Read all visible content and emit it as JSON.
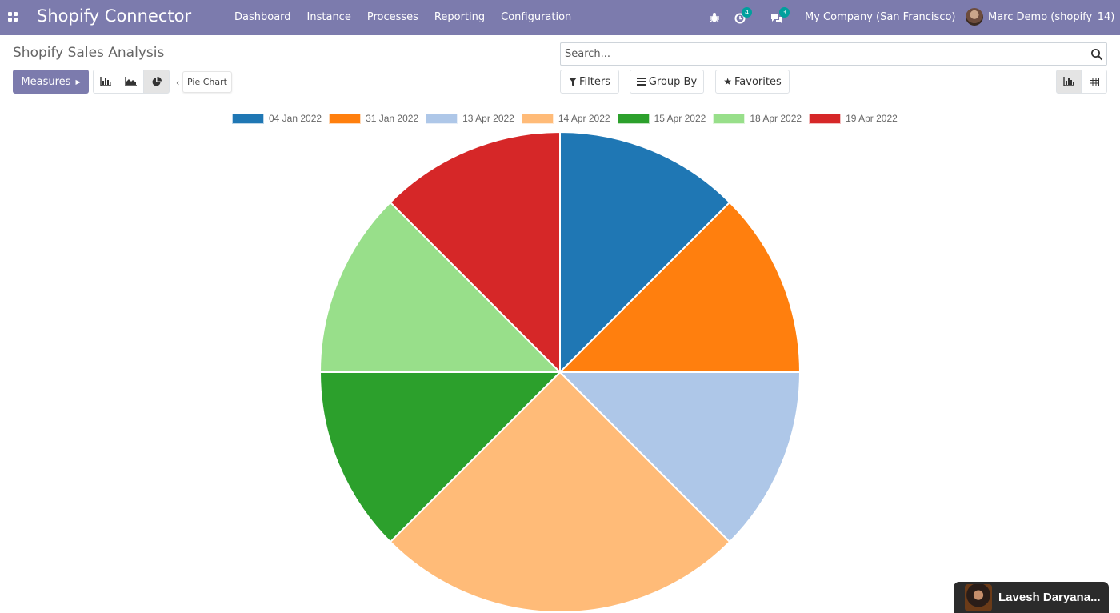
{
  "app": {
    "brand": "Shopify Connector",
    "menu": [
      "Dashboard",
      "Instance",
      "Processes",
      "Reporting",
      "Configuration"
    ],
    "activity_count": "4",
    "messages_count": "3",
    "company": "My Company (San Francisco)",
    "user": "Marc Demo (shopify_14)",
    "accent_color": "#7c7bad",
    "badge_color": "#00a09d"
  },
  "control": {
    "title": "Shopify Sales Analysis",
    "measures_label": "Measures",
    "search_placeholder": "Search...",
    "filters_label": "Filters",
    "groupby_label": "Group By",
    "favorites_label": "Favorites",
    "tooltip": "Pie Chart",
    "active_chart_mode": "pie",
    "active_view": "graph"
  },
  "chart_data": {
    "type": "pie",
    "categories": [
      "04 Jan 2022",
      "31 Jan 2022",
      "13 Apr 2022",
      "14 Apr 2022",
      "15 Apr 2022",
      "18 Apr 2022",
      "19 Apr 2022"
    ],
    "values": [
      1,
      1,
      1,
      2,
      1,
      1,
      1
    ],
    "colors": [
      "#1f77b4",
      "#ff7f0e",
      "#aec7e8",
      "#ffbb78",
      "#2ca02c",
      "#98df8a",
      "#d62728"
    ],
    "legend_position": "top"
  },
  "chat_widget": {
    "name": "Lavesh Daryana..."
  }
}
